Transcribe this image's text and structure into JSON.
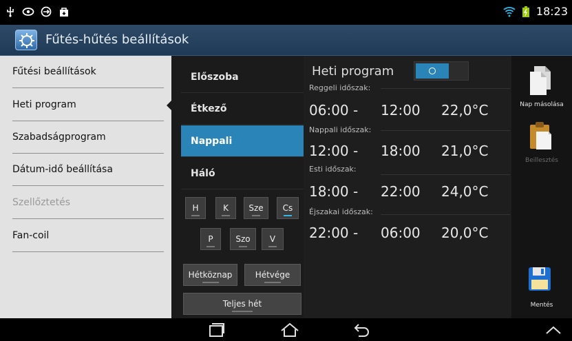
{
  "status": {
    "time": "18:23"
  },
  "app": {
    "title": "Fűtés-hűtés beállítások"
  },
  "sidebar": {
    "items": [
      {
        "label": "Fűtési beállítások",
        "enabled": true
      },
      {
        "label": "Heti program",
        "enabled": true,
        "selected": true
      },
      {
        "label": "Szabadságprogram",
        "enabled": true
      },
      {
        "label": "Dátum-idő beállítása",
        "enabled": true
      },
      {
        "label": "Szellőztetés",
        "enabled": false
      },
      {
        "label": "Fan-coil",
        "enabled": true
      }
    ]
  },
  "rooms": [
    {
      "label": "Előszoba"
    },
    {
      "label": "Étkező"
    },
    {
      "label": "Nappali",
      "selected": true
    },
    {
      "label": "Háló"
    }
  ],
  "days": {
    "row1": [
      "H",
      "K",
      "Sze",
      "Cs"
    ],
    "row2": [
      "P",
      "Szo",
      "V"
    ],
    "active": "Cs",
    "weekdays": "Hétköznap",
    "weekend": "Hétvége",
    "full_week": "Teljes hét"
  },
  "schedule": {
    "title": "Heti program",
    "toggle_on": true,
    "periods": [
      {
        "label": "Reggeli időszak:",
        "start": "06:00 -",
        "end": "12:00",
        "temp": "22,0°C"
      },
      {
        "label": "Nappali időszak:",
        "start": "12:00 -",
        "end": "18:00",
        "temp": "21,0°C"
      },
      {
        "label": "Esti időszak:",
        "start": "18:00 -",
        "end": "22:00",
        "temp": "24,0°C"
      },
      {
        "label": "Éjszakai időszak:",
        "start": "22:00 -",
        "end": "06:00",
        "temp": "20,0°C"
      }
    ]
  },
  "actions": {
    "copy_day": "Nap másolása",
    "paste": "Beillesztés",
    "save": "Mentés"
  },
  "colors": {
    "accent": "#2b84b8",
    "sidebar_bg": "#e2e2e2",
    "actionbar": "#24405d"
  },
  "icons": [
    "usb-icon",
    "eye-icon",
    "sync-icon",
    "bag-icon",
    "wifi-icon",
    "battery-icon",
    "recent-apps-icon",
    "home-icon",
    "back-icon",
    "chevron-up-icon",
    "copy-icon",
    "paste-icon",
    "save-icon"
  ]
}
